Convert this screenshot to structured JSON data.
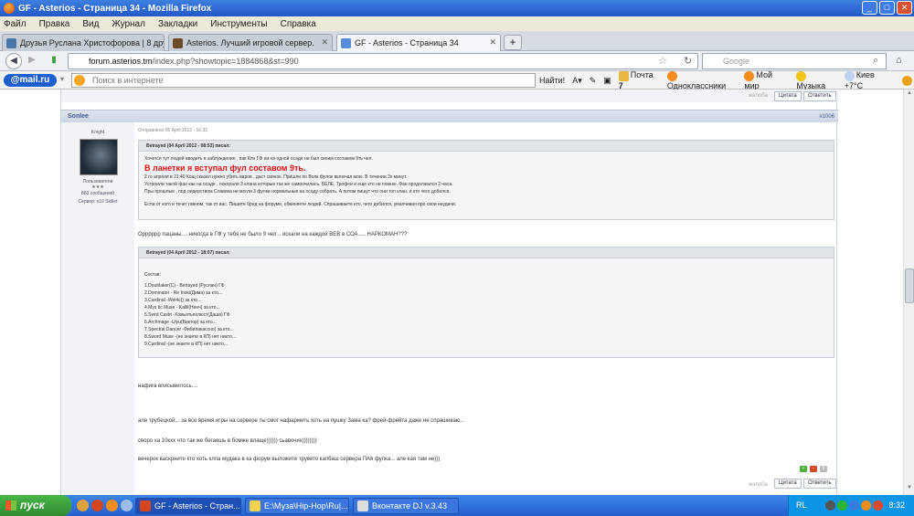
{
  "window": {
    "title": "GF - Asterios - Страница 34 - Mozilla Firefox"
  },
  "menu": [
    "Файл",
    "Правка",
    "Вид",
    "Журнал",
    "Закладки",
    "Инструменты",
    "Справка"
  ],
  "tabs": [
    {
      "label": "Друзья Руслана Христофорова | 8 дру..."
    },
    {
      "label": "Asterios. Лучший игровой сервер."
    },
    {
      "label": "GF - Asterios - Страница 34"
    }
  ],
  "nav": {
    "url_host": "forum.asterios.tm",
    "url_path": "/index.php?showtopic=1884868&st=990",
    "search_placeholder": "Google"
  },
  "mailru_bar": {
    "logo": "@mail.ru",
    "search_placeholder": "Поиск в интернете",
    "find_button": "Найти!",
    "mail_label": "Почта",
    "mail_count": "7",
    "odnoklassniki": "Одноклассники",
    "moi_mir": "Мой мир",
    "music": "Музыка",
    "weather": "Киев +7°C"
  },
  "post": {
    "top_buttons": [
      "Цитата",
      "Ответить"
    ],
    "top_grey": "жалоба",
    "author": "Sonlee",
    "number": "#1006",
    "profile": {
      "title": "Knight",
      "group": "Пользователи",
      "stars": "★★★",
      "posts": "883 сообщений",
      "server": "Сервер: x10 Skillet"
    },
    "date": "Отправлено 06 April 2012 - 16:32",
    "quote1": {
      "head": "Betrayed (04 April 2012 - 08:53) писал:",
      "line1": "Хочется тут людей вводить в заблуждение , пак Клн ГФ ни на одной осаде не был своим составом 9ть чел.",
      "red": "В ланетки я вступал фул составом 9ть.",
      "line2": "2 го апреля в 21:40 Кощ сказал нужно убить варов , даст свинок. Пришли по Волк фулок включая мою. В течении 3х минут.",
      "line3": "Устроили такой фан как на осаде , покорали 3 клана которые так же самоочились. БЕЛЕ, Трофеи и еще кто не помню. Фан продолжался 2 часа.",
      "line4": "Пры прошлые , под лидерством Славика не могли 3 фулки нормальные на осаду собрать. А потом пишут что они топ клан, и кто чего добился.",
      "line5": "Если от кого и течет гавном, так от вас. Пишите бред на форуме, обвиняете людей. Спрашиваете кто, чего добился, умалчивая про свои неудачи."
    },
    "reply1": "Орррррр пацаны.... никогда в ГФ у тебя не было 9 чел .. искали на каждой ВЕВ в СОА..... НАРКОМАН???",
    "quote2": {
      "head": "Betrayed (04 April 2012 - 18:07) писал:",
      "title": "Состав:",
      "items": [
        "1.Doublaker(C) - Betrayed (Руслан) ГФ",
        "2.Dominator - Re Inoki(Дима) за кто...",
        "3.Cardinal -Wel4c() за кто...",
        "4.Mys tic Muse - Kallil(Ненч) за кто...",
        "5.Swrd Castri -Хомьятьяхлюст(Даша) ГФ",
        "6.Archmage -Ulyu(Виктор) за кто...",
        "7.Spectral Dancer -Фибилакассно) за кто...",
        "8.Sword Muse -(не знаете в КП) нет никто...",
        "9.Cardinal -(не знаете в КП) нет никто..."
      ]
    },
    "reply2": "нафига вписывилось....",
    "reply3": "але трубецкой... за все время игры на сервере ты смог нафармить хоть на пушку Зама ка? фрей-фрейта даже не спрашиваю...",
    "reply4": "своро ха 10кхх что так же бегаешь в бомже влаще)))))) сьавочих))))))))",
    "reply5": "вечерок васкрните кто хоть клпа мудака в ка форум выложите трувето капбаш сервера ПАя фулка... але кая там не)))",
    "bottom_grey": "жалоба",
    "bottom_buttons": [
      "Цитата",
      "Ответить"
    ],
    "rating": [
      "+",
      "-",
      "0"
    ]
  },
  "taskbar": {
    "start": "пуск",
    "tasks": [
      {
        "label": "GF - Asterios - Стран..."
      },
      {
        "label": "E:\\Муза\\Hip-Hop\\Ru|..."
      },
      {
        "label": "Вконтакте DJ v.3.43"
      }
    ],
    "lang": "RL",
    "clock": "8:32"
  },
  "colors": {
    "titlebar": "#2a64d4",
    "red_text": "#e01010",
    "taskbar": "#2560d0",
    "start": "#3a9d3a"
  }
}
